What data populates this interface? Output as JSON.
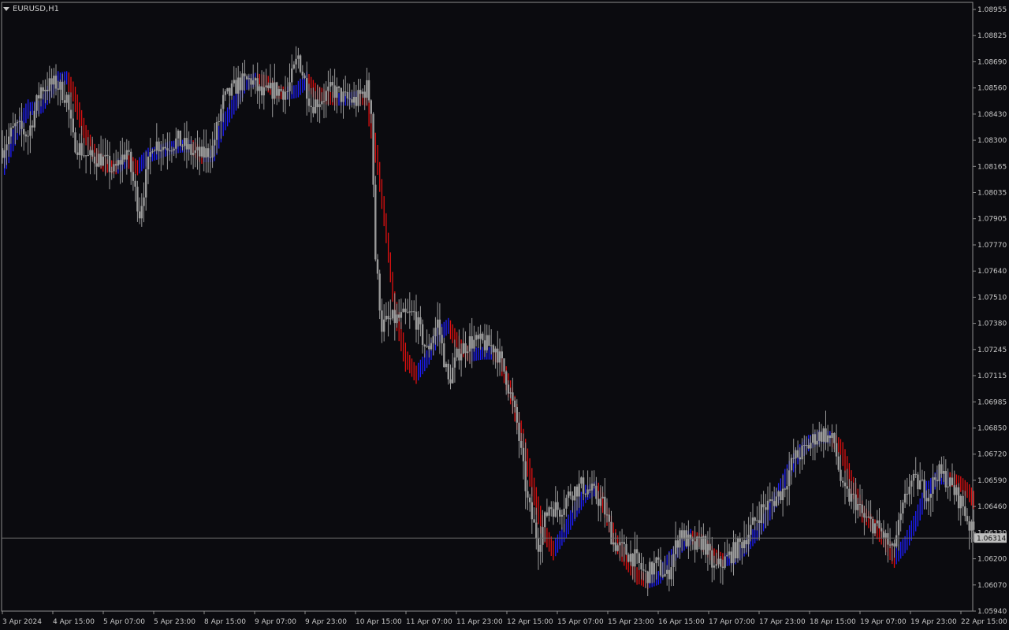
{
  "window": {
    "symbol_title": "EURUSD,H1"
  },
  "colors": {
    "background": "#0b0b0f",
    "candle": "#9a9a9a",
    "indicator_up": "#1e1eff",
    "indicator_down": "#e01010",
    "grid_axis": "#8c8c8c",
    "current_price_line": "#6e6e6e",
    "price_tag_bg": "#bfbfbf"
  },
  "chart_data": {
    "type": "candlestick",
    "title": "EURUSD,H1",
    "ylim": [
      1.0594,
      1.0902
    ],
    "y_ticks": [
      "1.08955",
      "1.08825",
      "1.08690",
      "1.08560",
      "1.08430",
      "1.08300",
      "1.08165",
      "1.08035",
      "1.07905",
      "1.07770",
      "1.07640",
      "1.07510",
      "1.07380",
      "1.07245",
      "1.07115",
      "1.06985",
      "1.06850",
      "1.06720",
      "1.06590",
      "1.06460",
      "1.06330",
      "1.06200",
      "1.06070",
      "1.05940"
    ],
    "x_ticks": [
      "3 Apr 2024",
      "4 Apr 15:00",
      "5 Apr 07:00",
      "5 Apr 23:00",
      "8 Apr 15:00",
      "9 Apr 07:00",
      "9 Apr 23:00",
      "10 Apr 15:00",
      "11 Apr 07:00",
      "11 Apr 23:00",
      "12 Apr 15:00",
      "15 Apr 07:00",
      "15 Apr 23:00",
      "16 Apr 15:00",
      "17 Apr 07:00",
      "17 Apr 23:00",
      "18 Apr 15:00",
      "19 Apr 07:00",
      "19 Apr 23:00",
      "22 Apr 15:00"
    ],
    "current_price": "1.06314",
    "series": [
      {
        "name": "price",
        "kind": "candles"
      },
      {
        "name": "",
        "kind": "indicator_band_up_down"
      }
    ],
    "price_path": [
      [
        0,
        1.0831
      ],
      [
        6,
        1.0842
      ],
      [
        12,
        1.0838
      ],
      [
        18,
        1.0862
      ],
      [
        25,
        1.0864
      ],
      [
        30,
        1.0857
      ],
      [
        33,
        1.0835
      ],
      [
        40,
        1.0826
      ],
      [
        46,
        1.0826
      ],
      [
        52,
        1.0819
      ],
      [
        58,
        1.083
      ],
      [
        64,
        1.0798
      ],
      [
        70,
        1.0834
      ],
      [
        76,
        1.0832
      ],
      [
        82,
        1.0835
      ],
      [
        88,
        1.0829
      ],
      [
        93,
        1.0827
      ],
      [
        98,
        1.0831
      ],
      [
        103,
        1.0855
      ],
      [
        110,
        1.0864
      ],
      [
        116,
        1.0866
      ],
      [
        121,
        1.0858
      ],
      [
        127,
        1.0861
      ],
      [
        133,
        1.086
      ],
      [
        138,
        1.0878
      ],
      [
        144,
        1.0853
      ],
      [
        148,
        1.0856
      ],
      [
        154,
        1.0861
      ],
      [
        160,
        1.0856
      ],
      [
        165,
        1.0855
      ],
      [
        170,
        1.0862
      ],
      [
        172,
        1.0852
      ],
      [
        174,
        1.0775
      ],
      [
        177,
        1.074
      ],
      [
        181,
        1.0743
      ],
      [
        186,
        1.0744
      ],
      [
        192,
        1.0746
      ],
      [
        198,
        1.0727
      ],
      [
        203,
        1.0742
      ],
      [
        208,
        1.0711
      ],
      [
        213,
        1.0727
      ],
      [
        218,
        1.0732
      ],
      [
        224,
        1.0731
      ],
      [
        230,
        1.0729
      ],
      [
        235,
        1.0714
      ],
      [
        240,
        1.069
      ],
      [
        245,
        1.065
      ],
      [
        250,
        1.0629
      ],
      [
        255,
        1.0648
      ],
      [
        260,
        1.0646
      ],
      [
        265,
        1.0655
      ],
      [
        270,
        1.0658
      ],
      [
        275,
        1.0655
      ],
      [
        280,
        1.0649
      ],
      [
        285,
        1.0629
      ],
      [
        290,
        1.0625
      ],
      [
        295,
        1.0621
      ],
      [
        300,
        1.0612
      ],
      [
        305,
        1.0618
      ],
      [
        310,
        1.0611
      ],
      [
        316,
        1.0635
      ],
      [
        322,
        1.0626
      ],
      [
        327,
        1.063
      ],
      [
        332,
        1.0615
      ],
      [
        338,
        1.0621
      ],
      [
        344,
        1.0628
      ],
      [
        349,
        1.0636
      ],
      [
        354,
        1.0646
      ],
      [
        359,
        1.065
      ],
      [
        364,
        1.0656
      ],
      [
        369,
        1.0672
      ],
      [
        374,
        1.0676
      ],
      [
        379,
        1.0683
      ],
      [
        383,
        1.0685
      ],
      [
        388,
        1.068
      ],
      [
        392,
        1.0655
      ],
      [
        398,
        1.065
      ],
      [
        402,
        1.0641
      ],
      [
        407,
        1.0638
      ],
      [
        411,
        1.0633
      ],
      [
        415,
        1.0624
      ],
      [
        419,
        1.0641
      ],
      [
        423,
        1.066
      ],
      [
        428,
        1.0659
      ],
      [
        432,
        1.0654
      ],
      [
        436,
        1.0665
      ],
      [
        440,
        1.0662
      ],
      [
        444,
        1.0655
      ],
      [
        448,
        1.0648
      ],
      [
        452,
        1.0635
      ]
    ],
    "indicator_path": [
      [
        0,
        1.082
      ],
      [
        6,
        1.0838
      ],
      [
        12,
        1.0851
      ],
      [
        18,
        1.0852
      ],
      [
        22,
        1.086
      ],
      [
        26,
        1.0866
      ],
      [
        30,
        1.0867
      ],
      [
        33,
        1.086
      ],
      [
        38,
        1.084
      ],
      [
        43,
        1.0828
      ],
      [
        48,
        1.0822
      ],
      [
        53,
        1.0821
      ],
      [
        58,
        1.0825
      ],
      [
        63,
        1.0821
      ],
      [
        68,
        1.0827
      ],
      [
        73,
        1.0829
      ],
      [
        78,
        1.0831
      ],
      [
        83,
        1.0832
      ],
      [
        88,
        1.0832
      ],
      [
        93,
        1.0827
      ],
      [
        98,
        1.0827
      ],
      [
        103,
        1.0843
      ],
      [
        108,
        1.0853
      ],
      [
        113,
        1.0864
      ],
      [
        118,
        1.0866
      ],
      [
        123,
        1.0865
      ],
      [
        127,
        1.086
      ],
      [
        132,
        1.0859
      ],
      [
        137,
        1.086
      ],
      [
        142,
        1.0866
      ],
      [
        146,
        1.086
      ],
      [
        151,
        1.0857
      ],
      [
        156,
        1.0856
      ],
      [
        161,
        1.0856
      ],
      [
        166,
        1.0857
      ],
      [
        170,
        1.0856
      ],
      [
        175,
        1.0825
      ],
      [
        179,
        1.079
      ],
      [
        183,
        1.075
      ],
      [
        188,
        1.0724
      ],
      [
        193,
        1.0715
      ],
      [
        198,
        1.0723
      ],
      [
        203,
        1.0735
      ],
      [
        208,
        1.074
      ],
      [
        213,
        1.073
      ],
      [
        218,
        1.0725
      ],
      [
        223,
        1.0726
      ],
      [
        228,
        1.0726
      ],
      [
        232,
        1.0724
      ],
      [
        237,
        1.0706
      ],
      [
        242,
        1.0685
      ],
      [
        247,
        1.066
      ],
      [
        252,
        1.0636
      ],
      [
        257,
        1.0625
      ],
      [
        262,
        1.0634
      ],
      [
        267,
        1.0645
      ],
      [
        272,
        1.0654
      ],
      [
        277,
        1.0657
      ],
      [
        281,
        1.0647
      ],
      [
        286,
        1.063
      ],
      [
        291,
        1.062
      ],
      [
        296,
        1.0612
      ],
      [
        301,
        1.0609
      ],
      [
        306,
        1.0611
      ],
      [
        311,
        1.062
      ],
      [
        316,
        1.0627
      ],
      [
        321,
        1.0632
      ],
      [
        326,
        1.063
      ],
      [
        331,
        1.0623
      ],
      [
        336,
        1.062
      ],
      [
        341,
        1.0621
      ],
      [
        346,
        1.0626
      ],
      [
        351,
        1.0633
      ],
      [
        356,
        1.0641
      ],
      [
        361,
        1.0652
      ],
      [
        366,
        1.0664
      ],
      [
        371,
        1.0674
      ],
      [
        376,
        1.068
      ],
      [
        381,
        1.0683
      ],
      [
        386,
        1.0683
      ],
      [
        391,
        1.0678
      ],
      [
        396,
        1.066
      ],
      [
        401,
        1.0645
      ],
      [
        406,
        1.0638
      ],
      [
        411,
        1.0631
      ],
      [
        416,
        1.0621
      ],
      [
        421,
        1.0628
      ],
      [
        426,
        1.064
      ],
      [
        431,
        1.0655
      ],
      [
        436,
        1.0662
      ],
      [
        441,
        1.0662
      ],
      [
        446,
        1.066
      ],
      [
        450,
        1.0656
      ],
      [
        453,
        1.0651
      ]
    ]
  }
}
